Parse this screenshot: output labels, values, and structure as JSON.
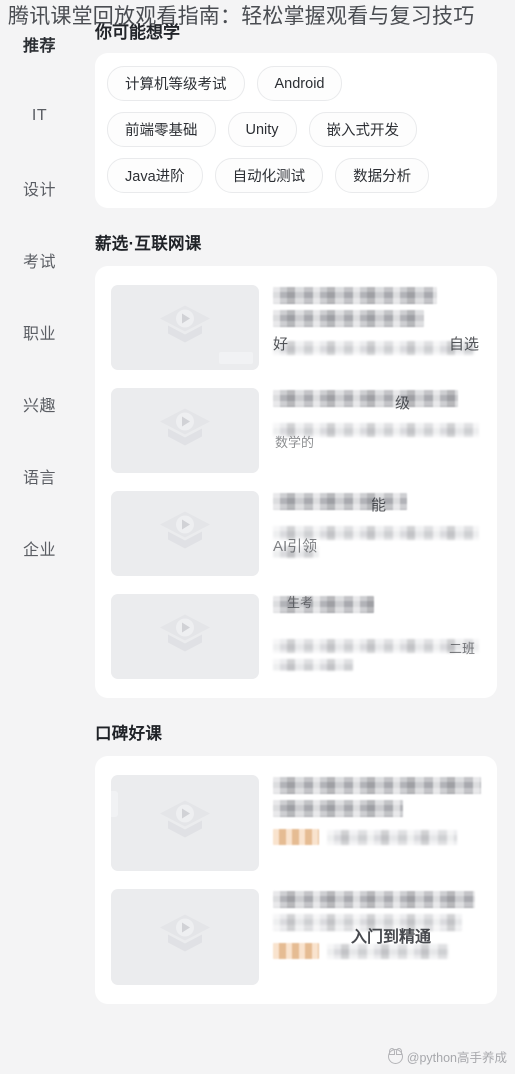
{
  "overlay": {
    "article_title": "腾讯课堂回放观看指南：轻松掌握观看与复习技巧"
  },
  "watermark": {
    "icon": "panda-avatar-icon",
    "text": "@python高手养成"
  },
  "sidebar": {
    "items": [
      {
        "label": "推荐",
        "active": true
      },
      {
        "label": "IT",
        "active": false
      },
      {
        "label": "设计",
        "active": false
      },
      {
        "label": "考试",
        "active": false
      },
      {
        "label": "职业",
        "active": false
      },
      {
        "label": "兴趣",
        "active": false
      },
      {
        "label": "语言",
        "active": false
      },
      {
        "label": "企业",
        "active": false
      }
    ]
  },
  "main": {
    "header": "你可能想学",
    "tag_rows": [
      [
        "计算机等级考试",
        "Android"
      ],
      [
        "前端零基础",
        "Unity",
        "嵌入式开发"
      ],
      [
        "Java进阶",
        "自动化测试",
        "数据分析"
      ]
    ],
    "sections": [
      {
        "title": "薪选·互联网课",
        "rows": [
          {
            "thumbnail": "course-placeholder-icon",
            "title_redacted": true,
            "subtitle_redacted": true,
            "visible_fragments": [
              "好",
              "自选"
            ]
          },
          {
            "thumbnail": "course-placeholder-icon",
            "title_redacted": true,
            "subtitle_redacted": true,
            "visible_fragments": [
              "级",
              "数学的"
            ]
          },
          {
            "thumbnail": "course-placeholder-icon",
            "title_redacted": true,
            "subtitle_redacted": true,
            "visible_fragments": [
              "能",
              "AI引领"
            ]
          },
          {
            "thumbnail": "course-placeholder-icon",
            "title_redacted": true,
            "subtitle_redacted": true,
            "visible_fragments": [
              "生考",
              "二班"
            ]
          }
        ]
      },
      {
        "title": "口碑好课",
        "rows": [
          {
            "thumbnail": "course-placeholder-icon",
            "title_redacted": true,
            "subtitle_redacted": true,
            "has_promo_badge": true,
            "visible_fragments": []
          },
          {
            "thumbnail": "course-placeholder-icon",
            "title_redacted": true,
            "subtitle_redacted": true,
            "has_promo_badge": true,
            "visible_fragments": [
              "入门到精通"
            ]
          }
        ]
      }
    ]
  },
  "colors": {
    "page_background": "#f4f4f5",
    "card_background": "#ffffff",
    "text_primary": "#1f2227",
    "text_secondary": "#5a5d63",
    "chip_border": "#e9eaec",
    "thumb_placeholder": "#ebecee",
    "promo_badge": "#f3c79c"
  }
}
